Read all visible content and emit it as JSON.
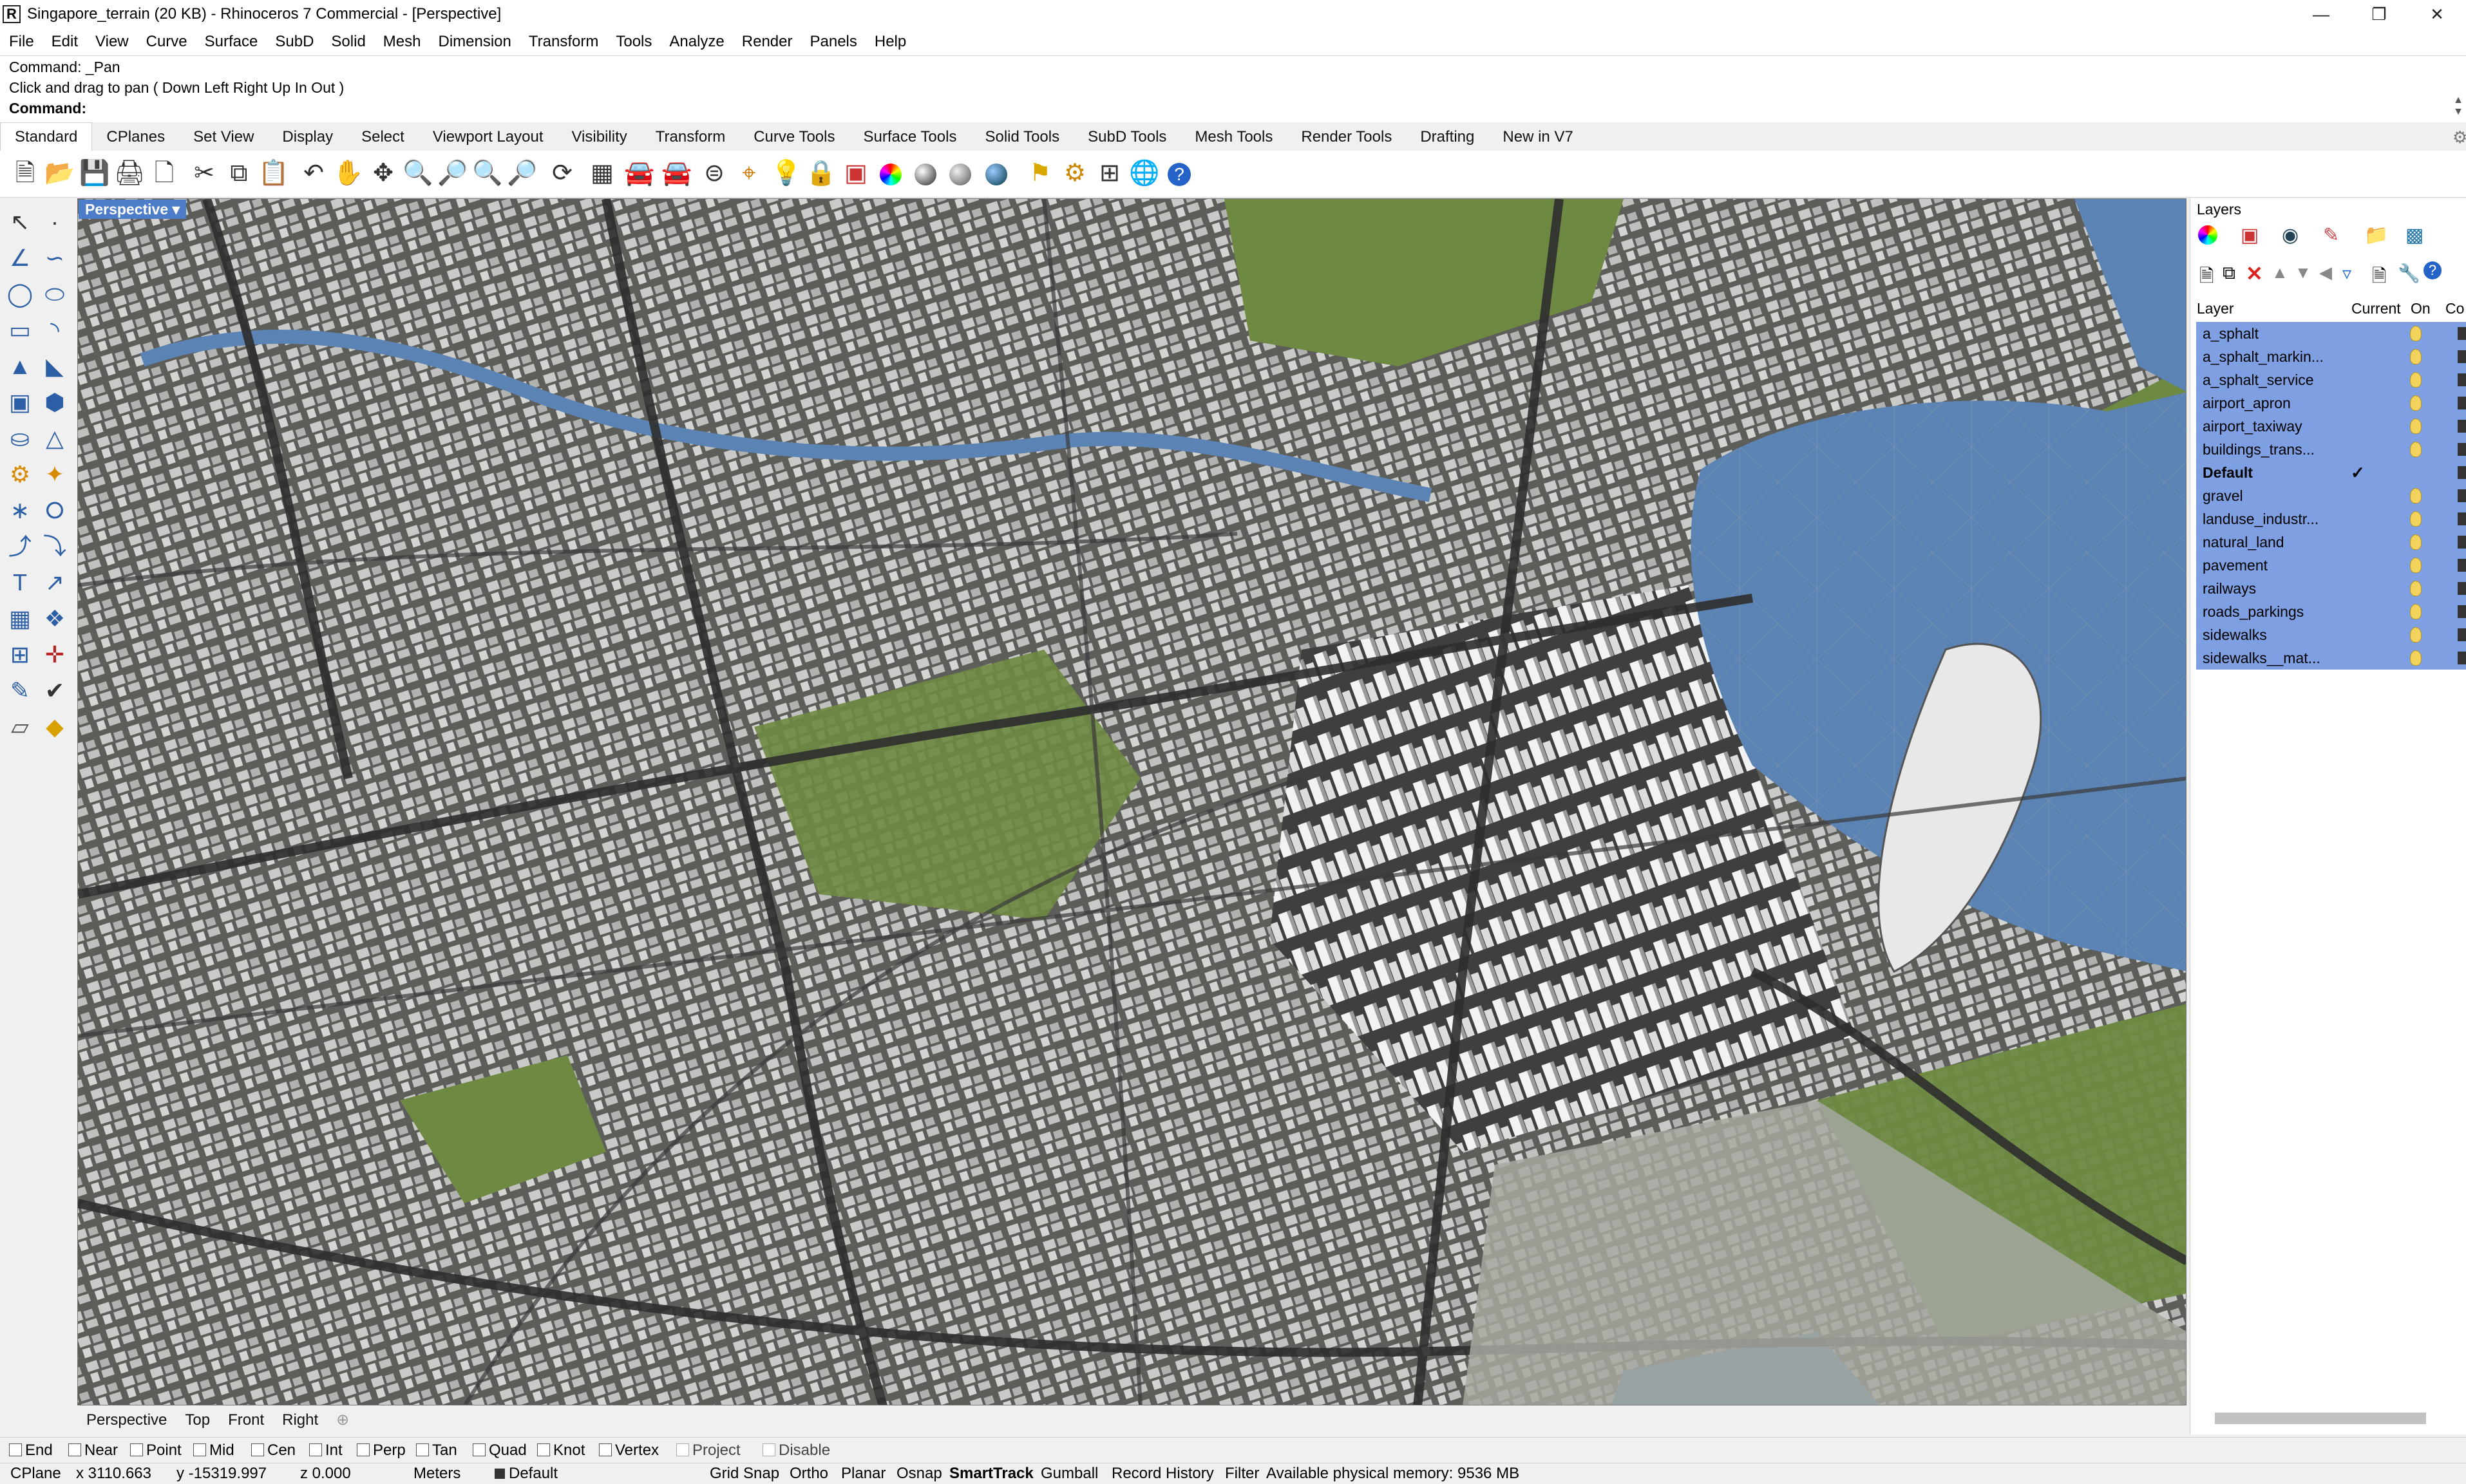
{
  "window": {
    "title": "Singapore_terrain (20 KB) - Rhinoceros 7 Commercial - [Perspective]",
    "app_icon": "rhino-app-icon",
    "controls": [
      "minimize-icon",
      "maximize-icon",
      "close-icon"
    ]
  },
  "menu": [
    "File",
    "Edit",
    "View",
    "Curve",
    "Surface",
    "SubD",
    "Solid",
    "Mesh",
    "Dimension",
    "Transform",
    "Tools",
    "Analyze",
    "Render",
    "Panels",
    "Help"
  ],
  "command": {
    "history_line1": "Command: _Pan",
    "history_line2": "Click and drag to pan ( Down  Left  Right  Up  In  Out )",
    "prompt_label": "Command:",
    "input_value": ""
  },
  "toolbar_tabs": [
    "Standard",
    "CPlanes",
    "Set View",
    "Display",
    "Select",
    "Viewport Layout",
    "Visibility",
    "Transform",
    "Curve Tools",
    "Surface Tools",
    "Solid Tools",
    "SubD Tools",
    "Mesh Tools",
    "Render Tools",
    "Drafting",
    "New in V7"
  ],
  "active_toolbar_tab": "Standard",
  "standard_icons": [
    "new-icon",
    "open-icon",
    "save-icon",
    "print-icon",
    "import-icon",
    "cut-icon",
    "copy-icon",
    "paste-icon",
    "undo-icon",
    "pan-hand-icon",
    "move-icon",
    "zoom-icon",
    "zoom-window-icon",
    "zoom-extents-icon",
    "zoom-selected-icon",
    "rotate-view-icon",
    "grid-4-view-icon",
    "car-icon",
    "car-blocks-icon",
    "cplane-icon",
    "dimension-icon",
    "light-icon",
    "lock-icon",
    "layers-icon",
    "color-wheel-icon",
    "sphere-shaded-icon",
    "sphere-render-icon",
    "sphere-blue-icon",
    "lamp-icon",
    "settings-gear-icon",
    "grid-snap-icon",
    "globe-icon",
    "help-icon"
  ],
  "left_tools": [
    "select-arrow-icon",
    "point-icon",
    "polyline-icon",
    "curve-icon",
    "circle-icon",
    "ellipse-icon",
    "rectangle-icon",
    "arc-icon",
    "surface-icon",
    "loft-icon",
    "box-icon",
    "extrude-icon",
    "cylinder-icon",
    "mesh-icon",
    "transform-icon",
    "drafting-icon",
    "boolean-icon",
    "render-icon",
    "fillet-icon",
    "offset-icon",
    "text-icon",
    "dimension-icon",
    "grid-icon",
    "check-icon",
    "analyze-icon",
    "color-icon",
    "array-icon",
    "gumball-icon",
    "block-icon",
    "layout-icon"
  ],
  "viewport": {
    "label": "Perspective",
    "view_tabs": [
      "Perspective",
      "Top",
      "Front",
      "Right"
    ]
  },
  "layers_panel": {
    "title": "Layers",
    "columns": [
      "Layer",
      "Current",
      "On",
      "Co"
    ],
    "rows": [
      {
        "name": "a_sphalt",
        "current": ""
      },
      {
        "name": "a_sphalt_markin...",
        "current": ""
      },
      {
        "name": "a_sphalt_service",
        "current": ""
      },
      {
        "name": "airport_apron",
        "current": ""
      },
      {
        "name": "airport_taxiway",
        "current": ""
      },
      {
        "name": "buildings_trans...",
        "current": ""
      },
      {
        "name": "Default",
        "current": "✓"
      },
      {
        "name": "gravel",
        "current": ""
      },
      {
        "name": "landuse_industr...",
        "current": ""
      },
      {
        "name": "natural_land",
        "current": ""
      },
      {
        "name": "pavement",
        "current": ""
      },
      {
        "name": "railways",
        "current": ""
      },
      {
        "name": "roads_parkings",
        "current": ""
      },
      {
        "name": "sidewalks",
        "current": ""
      },
      {
        "name": "sidewalks__mat...",
        "current": ""
      }
    ]
  },
  "osnaps": [
    "End",
    "Near",
    "Point",
    "Mid",
    "Cen",
    "Int",
    "Perp",
    "Tan",
    "Quad",
    "Knot",
    "Vertex",
    "Project",
    "Disable"
  ],
  "status": {
    "cplane": "CPlane",
    "x": "x 3110.663",
    "y": "y -15319.997",
    "z": "z 0.000",
    "units": "Meters",
    "layer": "Default",
    "toggles": [
      "Grid Snap",
      "Ortho",
      "Planar",
      "Osnap",
      "SmartTrack",
      "Gumball",
      "Record History",
      "Filter"
    ],
    "memory": "Available physical memory: 9536 MB"
  },
  "colors": {
    "selection_blue": "#7e9fe2",
    "viewport_label": "#4d7cc9",
    "water": "#5b84b4",
    "park_green": "#6e8a42"
  }
}
